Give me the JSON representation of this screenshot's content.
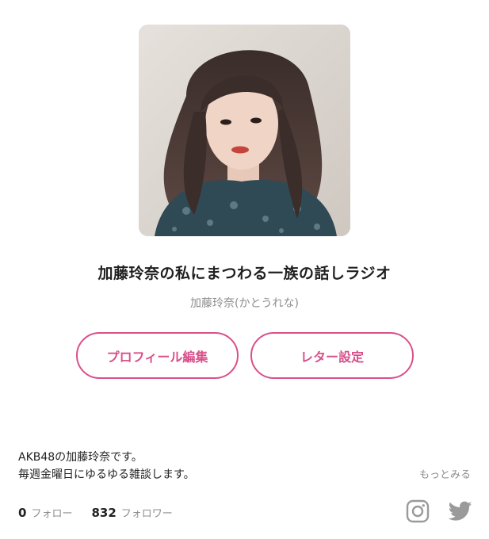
{
  "profile": {
    "channel_title": "加藤玲奈の私にまつわる一族の話しラジオ",
    "name": "加藤玲奈(かとうれな)"
  },
  "buttons": {
    "edit_profile": "プロフィール編集",
    "letter_settings": "レター設定"
  },
  "bio": {
    "line1": "AKB48の加藤玲奈です。",
    "line2": "毎週金曜日にゆるゆる雑談します。",
    "more": "もっとみる"
  },
  "stats": {
    "following_count": "0",
    "following_label": "フォロー",
    "followers_count": "832",
    "followers_label": "フォロワー"
  },
  "icons": {
    "instagram": "instagram-icon",
    "twitter": "twitter-icon"
  },
  "colors": {
    "accent": "#d8508b",
    "muted": "#8e8e8e",
    "social_icon": "#9a9a9a"
  }
}
